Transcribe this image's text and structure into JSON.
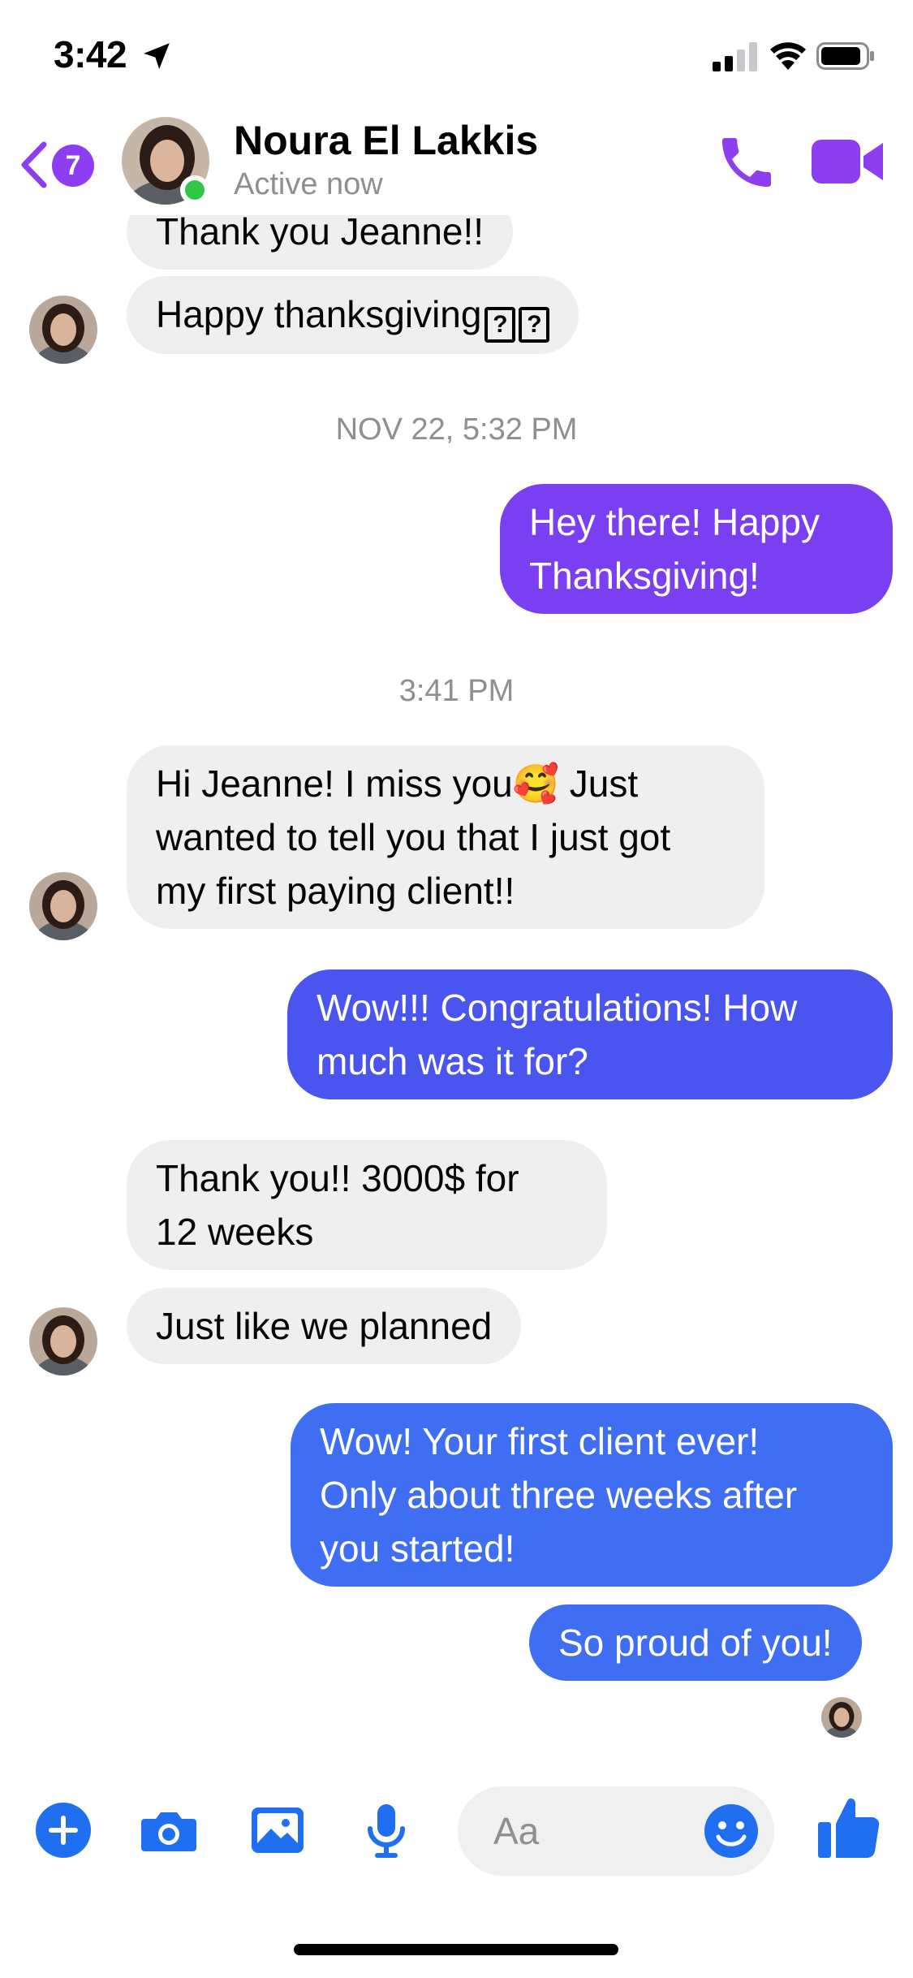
{
  "status_bar": {
    "time": "3:42"
  },
  "header": {
    "unread_count": "7",
    "contact_name": "Noura El Lakkis",
    "contact_status": "Active now"
  },
  "messages": [
    {
      "side": "in",
      "text": "Thank you Jeanne!!"
    },
    {
      "side": "in",
      "text": "Happy thanksgiving",
      "unrendered_glyphs": [
        "?",
        "?"
      ]
    },
    {
      "timestamp": "NOV 22, 5:32 PM"
    },
    {
      "side": "out",
      "lines": [
        "Hey there! Happy",
        "Thanksgiving!"
      ]
    },
    {
      "timestamp": "3:41 PM"
    },
    {
      "side": "in",
      "lines": [
        "Hi Jeanne! I miss you",
        "🥰",
        " Just",
        "wanted to tell you that I just got",
        "my first paying client!!"
      ]
    },
    {
      "side": "out",
      "lines": [
        "Wow!!! Congratulations! How",
        "much was it for?"
      ]
    },
    {
      "side": "in",
      "lines": [
        "Thank you!! 3000$ for",
        "12 weeks"
      ]
    },
    {
      "side": "in",
      "text": "Just like we planned"
    },
    {
      "side": "out",
      "lines": [
        "Wow! Your first client ever!",
        "Only about three weeks after",
        "you started!"
      ]
    },
    {
      "side": "out",
      "text": "So proud of you!"
    }
  ],
  "composer": {
    "placeholder": "Aa"
  },
  "colors": {
    "accent": "#8c3ef0",
    "online": "#31c748",
    "incoming_bubble": "#efefef",
    "outgoing_gradient": [
      "#7b3ff2",
      "#4a55f0",
      "#3f6ef3"
    ],
    "composer_icons": "#1f6ff0"
  },
  "icons": {
    "status": [
      "location-arrow-icon",
      "signal-icon",
      "wifi-icon",
      "battery-icon"
    ],
    "header": [
      "back-chevron-icon",
      "phone-icon",
      "video-camera-icon"
    ],
    "composer": [
      "plus-icon",
      "camera-icon",
      "image-icon",
      "microphone-icon",
      "emoji-icon",
      "thumbs-up-icon"
    ]
  }
}
